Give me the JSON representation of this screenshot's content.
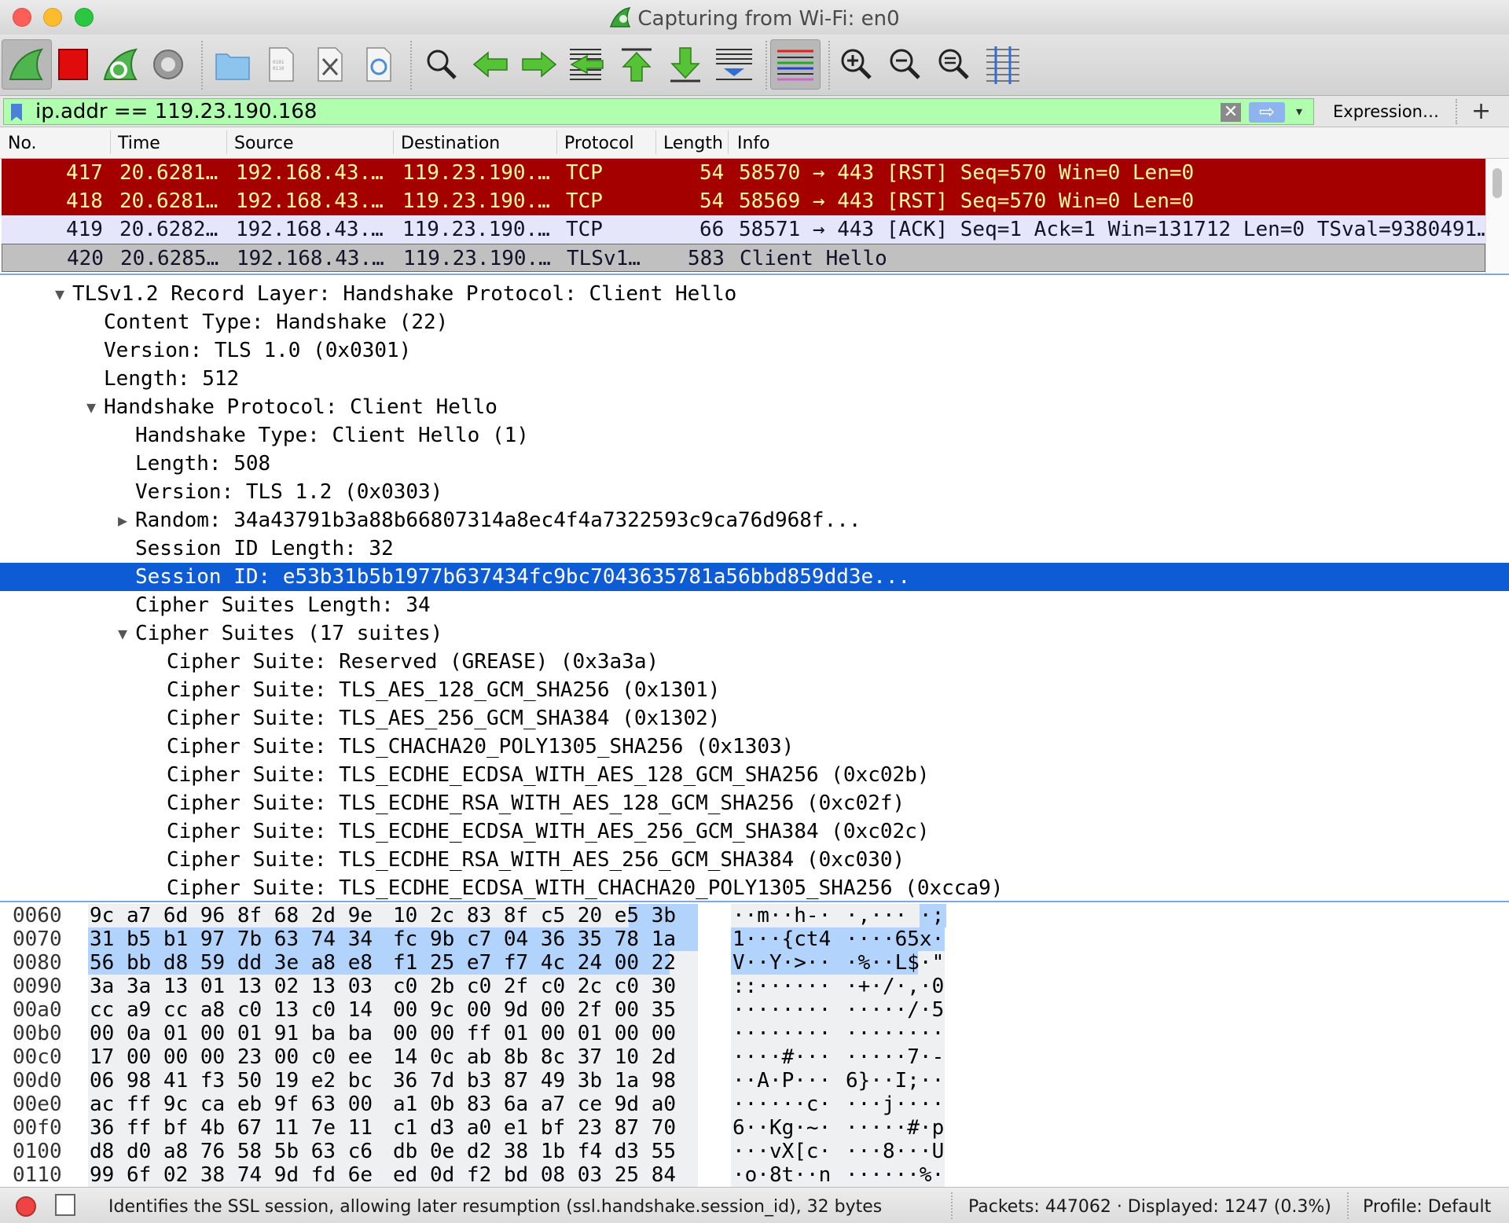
{
  "window": {
    "title": "Capturing from Wi-Fi: en0"
  },
  "toolbar": {
    "buttons": [
      "start-capture",
      "stop-capture",
      "restart-capture",
      "capture-options",
      "open-file",
      "save-file",
      "close-file",
      "reload-file",
      "find-packet",
      "go-back",
      "go-forward",
      "go-to-packet",
      "go-first",
      "go-last",
      "auto-scroll",
      "colorize",
      "zoom-in",
      "zoom-out",
      "normal-size",
      "resize-columns"
    ]
  },
  "filter": {
    "value": "ip.addr == 119.23.190.168",
    "expression_label": "Expression…",
    "add_label": "+",
    "clear_glyph": "✕",
    "apply_glyph": "⇨",
    "dropdown_glyph": "▾",
    "bg_color": "#afffaf"
  },
  "packet_list": {
    "headers": [
      "No.",
      "Time",
      "Source",
      "Destination",
      "Protocol",
      "Length",
      "Info"
    ],
    "rows": [
      {
        "no": "417",
        "time": "20.6281…",
        "src": "192.168.43.…",
        "dst": "119.23.190.…",
        "proto": "TCP",
        "len": "54",
        "info": "58570 → 443 [RST] Seq=570 Win=0 Len=0"
      },
      {
        "no": "418",
        "time": "20.6281…",
        "src": "192.168.43.…",
        "dst": "119.23.190.…",
        "proto": "TCP",
        "len": "54",
        "info": "58569 → 443 [RST] Seq=570 Win=0 Len=0"
      },
      {
        "no": "419",
        "time": "20.6282…",
        "src": "192.168.43.…",
        "dst": "119.23.190.…",
        "proto": "TCP",
        "len": "66",
        "info": "58571 → 443 [ACK] Seq=1 Ack=1 Win=131712 Len=0 TSval=9380491…"
      },
      {
        "no": "420",
        "time": "20.6285…",
        "src": "192.168.43.…",
        "dst": "119.23.190.…",
        "proto": "TLSv1…",
        "len": "583",
        "info": "Client Hello"
      }
    ],
    "colors": {
      "rst_bg": "#a40000",
      "rst_fg": "#fffc9c",
      "ack_bg": "#e6e6fa",
      "hello_bg": "#c0c0c0"
    }
  },
  "details": {
    "rows": [
      {
        "arrow": "▼",
        "text": "TLSv1.2 Record Layer: Handshake Protocol: Client Hello"
      },
      {
        "arrow": "",
        "text": "Content Type: Handshake (22)"
      },
      {
        "arrow": "",
        "text": "Version: TLS 1.0 (0x0301)"
      },
      {
        "arrow": "",
        "text": "Length: 512"
      },
      {
        "arrow": "▼",
        "text": "Handshake Protocol: Client Hello"
      },
      {
        "arrow": "",
        "text": "Handshake Type: Client Hello (1)"
      },
      {
        "arrow": "",
        "text": "Length: 508"
      },
      {
        "arrow": "",
        "text": "Version: TLS 1.2 (0x0303)"
      },
      {
        "arrow": "▶",
        "text": "Random: 34a43791b3a88b66807314a8ec4f4a7322593c9ca76d968f..."
      },
      {
        "arrow": "",
        "text": "Session ID Length: 32"
      },
      {
        "arrow": "",
        "text": "Session ID: e53b31b5b1977b637434fc9bc7043635781a56bbd859dd3e..."
      },
      {
        "arrow": "",
        "text": "Cipher Suites Length: 34"
      },
      {
        "arrow": "▼",
        "text": "Cipher Suites (17 suites)"
      },
      {
        "arrow": "",
        "text": "Cipher Suite: Reserved (GREASE) (0x3a3a)"
      },
      {
        "arrow": "",
        "text": "Cipher Suite: TLS_AES_128_GCM_SHA256 (0x1301)"
      },
      {
        "arrow": "",
        "text": "Cipher Suite: TLS_AES_256_GCM_SHA384 (0x1302)"
      },
      {
        "arrow": "",
        "text": "Cipher Suite: TLS_CHACHA20_POLY1305_SHA256 (0x1303)"
      },
      {
        "arrow": "",
        "text": "Cipher Suite: TLS_ECDHE_ECDSA_WITH_AES_128_GCM_SHA256 (0xc02b)"
      },
      {
        "arrow": "",
        "text": "Cipher Suite: TLS_ECDHE_RSA_WITH_AES_128_GCM_SHA256 (0xc02f)"
      },
      {
        "arrow": "",
        "text": "Cipher Suite: TLS_ECDHE_ECDSA_WITH_AES_256_GCM_SHA384 (0xc02c)"
      },
      {
        "arrow": "",
        "text": "Cipher Suite: TLS_ECDHE_RSA_WITH_AES_256_GCM_SHA384 (0xc030)"
      },
      {
        "arrow": "",
        "text": "Cipher Suite: TLS_ECDHE_ECDSA_WITH_CHACHA20_POLY1305_SHA256 (0xcca9)"
      }
    ],
    "selected_text": "Session ID: e53b31b5b1977b637434fc9bc7043635781a56bbd859dd3e...",
    "selection_color": "#0e5bd6"
  },
  "hex": {
    "rows": [
      {
        "offset": "0060",
        "hex1": "9c a7 6d 96 8f 68 2d 9e",
        "hex2": "10 2c 83 8f c5 20 e5 3b",
        "ascii1": "··m··h-·",
        "ascii2": "·,··· ·;"
      },
      {
        "offset": "0070",
        "hex1": "31 b5 b1 97 7b 63 74 34",
        "hex2": "fc 9b c7 04 36 35 78 1a",
        "ascii1": "1···{ct4",
        "ascii2": "····65x·"
      },
      {
        "offset": "0080",
        "hex1": "56 bb d8 59 dd 3e a8 e8",
        "hex2": "f1 25 e7 f7 4c 24 00 22",
        "ascii1": "V··Y·>··",
        "ascii2": "·%··L$·\""
      },
      {
        "offset": "0090",
        "hex1": "3a 3a 13 01 13 02 13 03",
        "hex2": "c0 2b c0 2f c0 2c c0 30",
        "ascii1": "::······",
        "ascii2": "·+·/·,·0"
      },
      {
        "offset": "00a0",
        "hex1": "cc a9 cc a8 c0 13 c0 14",
        "hex2": "00 9c 00 9d 00 2f 00 35",
        "ascii1": "········",
        "ascii2": "·····/·5"
      },
      {
        "offset": "00b0",
        "hex1": "00 0a 01 00 01 91 ba ba",
        "hex2": "00 00 ff 01 00 01 00 00",
        "ascii1": "········",
        "ascii2": "········"
      },
      {
        "offset": "00c0",
        "hex1": "17 00 00 00 23 00 c0 ee",
        "hex2": "14 0c ab 8b 8c 37 10 2d",
        "ascii1": "····#···",
        "ascii2": "·····7·-"
      },
      {
        "offset": "00d0",
        "hex1": "06 98 41 f3 50 19 e2 bc",
        "hex2": "36 7d b3 87 49 3b 1a 98",
        "ascii1": "··A·P···",
        "ascii2": "6}··I;··"
      },
      {
        "offset": "00e0",
        "hex1": "ac ff 9c ca eb 9f 63 00",
        "hex2": "a1 0b 83 6a a7 ce 9d a0",
        "ascii1": "······c·",
        "ascii2": "···j····"
      },
      {
        "offset": "00f0",
        "hex1": "36 ff bf 4b 67 11 7e 11",
        "hex2": "c1 d3 a0 e1 bf 23 87 70",
        "ascii1": "6··Kg·~·",
        "ascii2": "·····#·p"
      },
      {
        "offset": "0100",
        "hex1": "d8 d0 a8 76 58 5b 63 c6",
        "hex2": "db 0e d2 38 1b f4 d3 55",
        "ascii1": "···vX[c·",
        "ascii2": "···8···U"
      },
      {
        "offset": "0110",
        "hex1": "99 6f 02 38 74 9d fd 6e",
        "hex2": "ed 0d f2 bd 08 03 25 84",
        "ascii1": "·o·8t··n",
        "ascii2": "······%·"
      }
    ],
    "highlight_color": "#b2d3fc"
  },
  "status": {
    "message": "Identifies the SSL session, allowing later resumption (ssl.handshake.session_id), 32 bytes",
    "packets": "Packets: 447062 · Displayed: 1247 (0.3%)",
    "profile": "Profile: Default"
  }
}
